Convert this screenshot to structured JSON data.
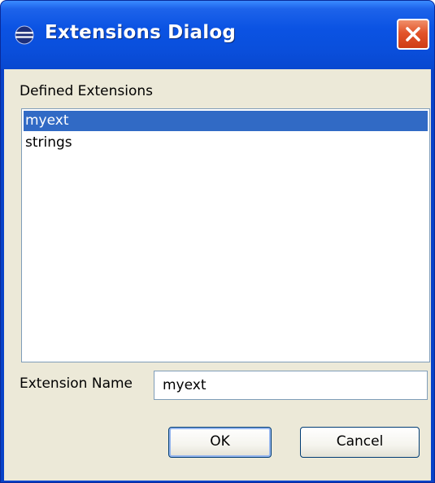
{
  "window": {
    "title": "Extensions Dialog",
    "icon": "eclipse-icon",
    "close_icon": "close-icon"
  },
  "defined_extensions": {
    "label": "Defined Extensions",
    "items": [
      {
        "label": "myext",
        "selected": true
      },
      {
        "label": "strings",
        "selected": false
      }
    ]
  },
  "extension_name": {
    "label": "Extension Name",
    "value": "myext"
  },
  "buttons": {
    "ok_label": "OK",
    "cancel_label": "Cancel"
  },
  "colors": {
    "titlebar": "#0a4fdc",
    "close_button": "#e2542a",
    "dialog_background": "#ece9d8",
    "selection": "#316ac5",
    "field_border": "#7f9db9"
  }
}
